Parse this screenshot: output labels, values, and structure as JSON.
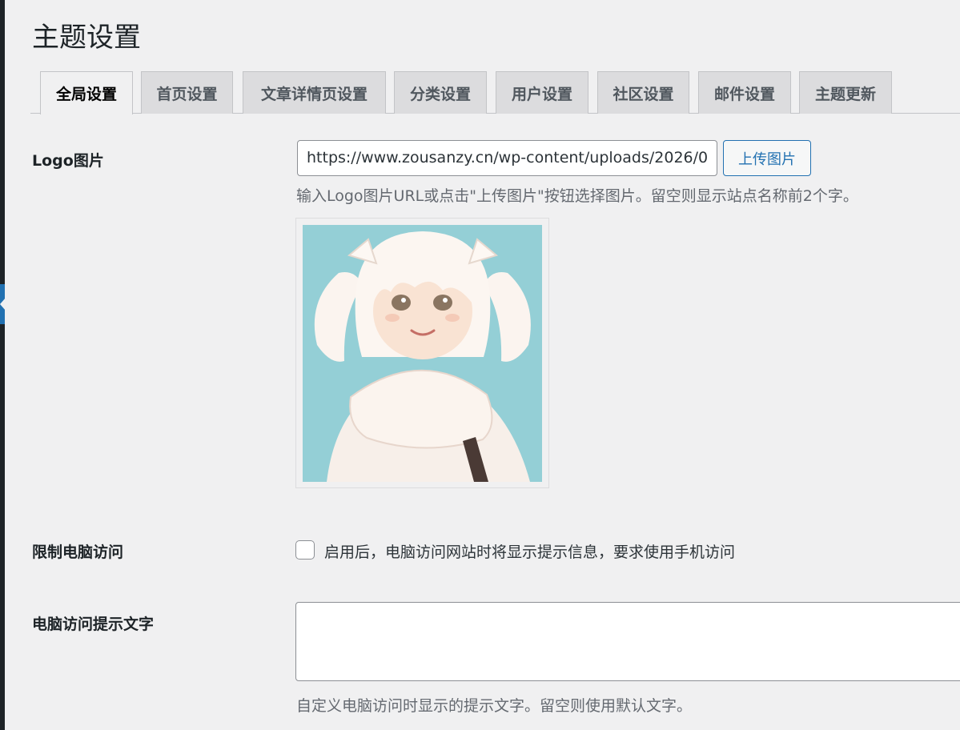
{
  "page": {
    "title": "主题设置"
  },
  "tabs": [
    {
      "label": "全局设置",
      "active": true
    },
    {
      "label": "首页设置"
    },
    {
      "label": "文章详情页设置"
    },
    {
      "label": "分类设置"
    },
    {
      "label": "用户设置"
    },
    {
      "label": "社区设置"
    },
    {
      "label": "邮件设置"
    },
    {
      "label": "主题更新"
    }
  ],
  "logo": {
    "label": "Logo图片",
    "url_value": "https://www.zousanzy.cn/wp-content/uploads/2026/0",
    "upload_button": "上传图片",
    "description": "输入Logo图片URL或点击\"上传图片\"按钮选择图片。留空则显示站点名称前2个字。"
  },
  "restrict_pc": {
    "label": "限制电脑访问",
    "checked": false,
    "checkbox_label": "启用后，电脑访问网站时将显示提示信息，要求使用手机访问"
  },
  "pc_notice": {
    "label": "电脑访问提示文字",
    "value": "",
    "description": "自定义电脑访问时显示的提示文字。留空则使用默认文字。"
  },
  "colors": {
    "accent": "#2271b1",
    "background": "#f0f0f1",
    "preview_bg": "#94cfd6"
  }
}
